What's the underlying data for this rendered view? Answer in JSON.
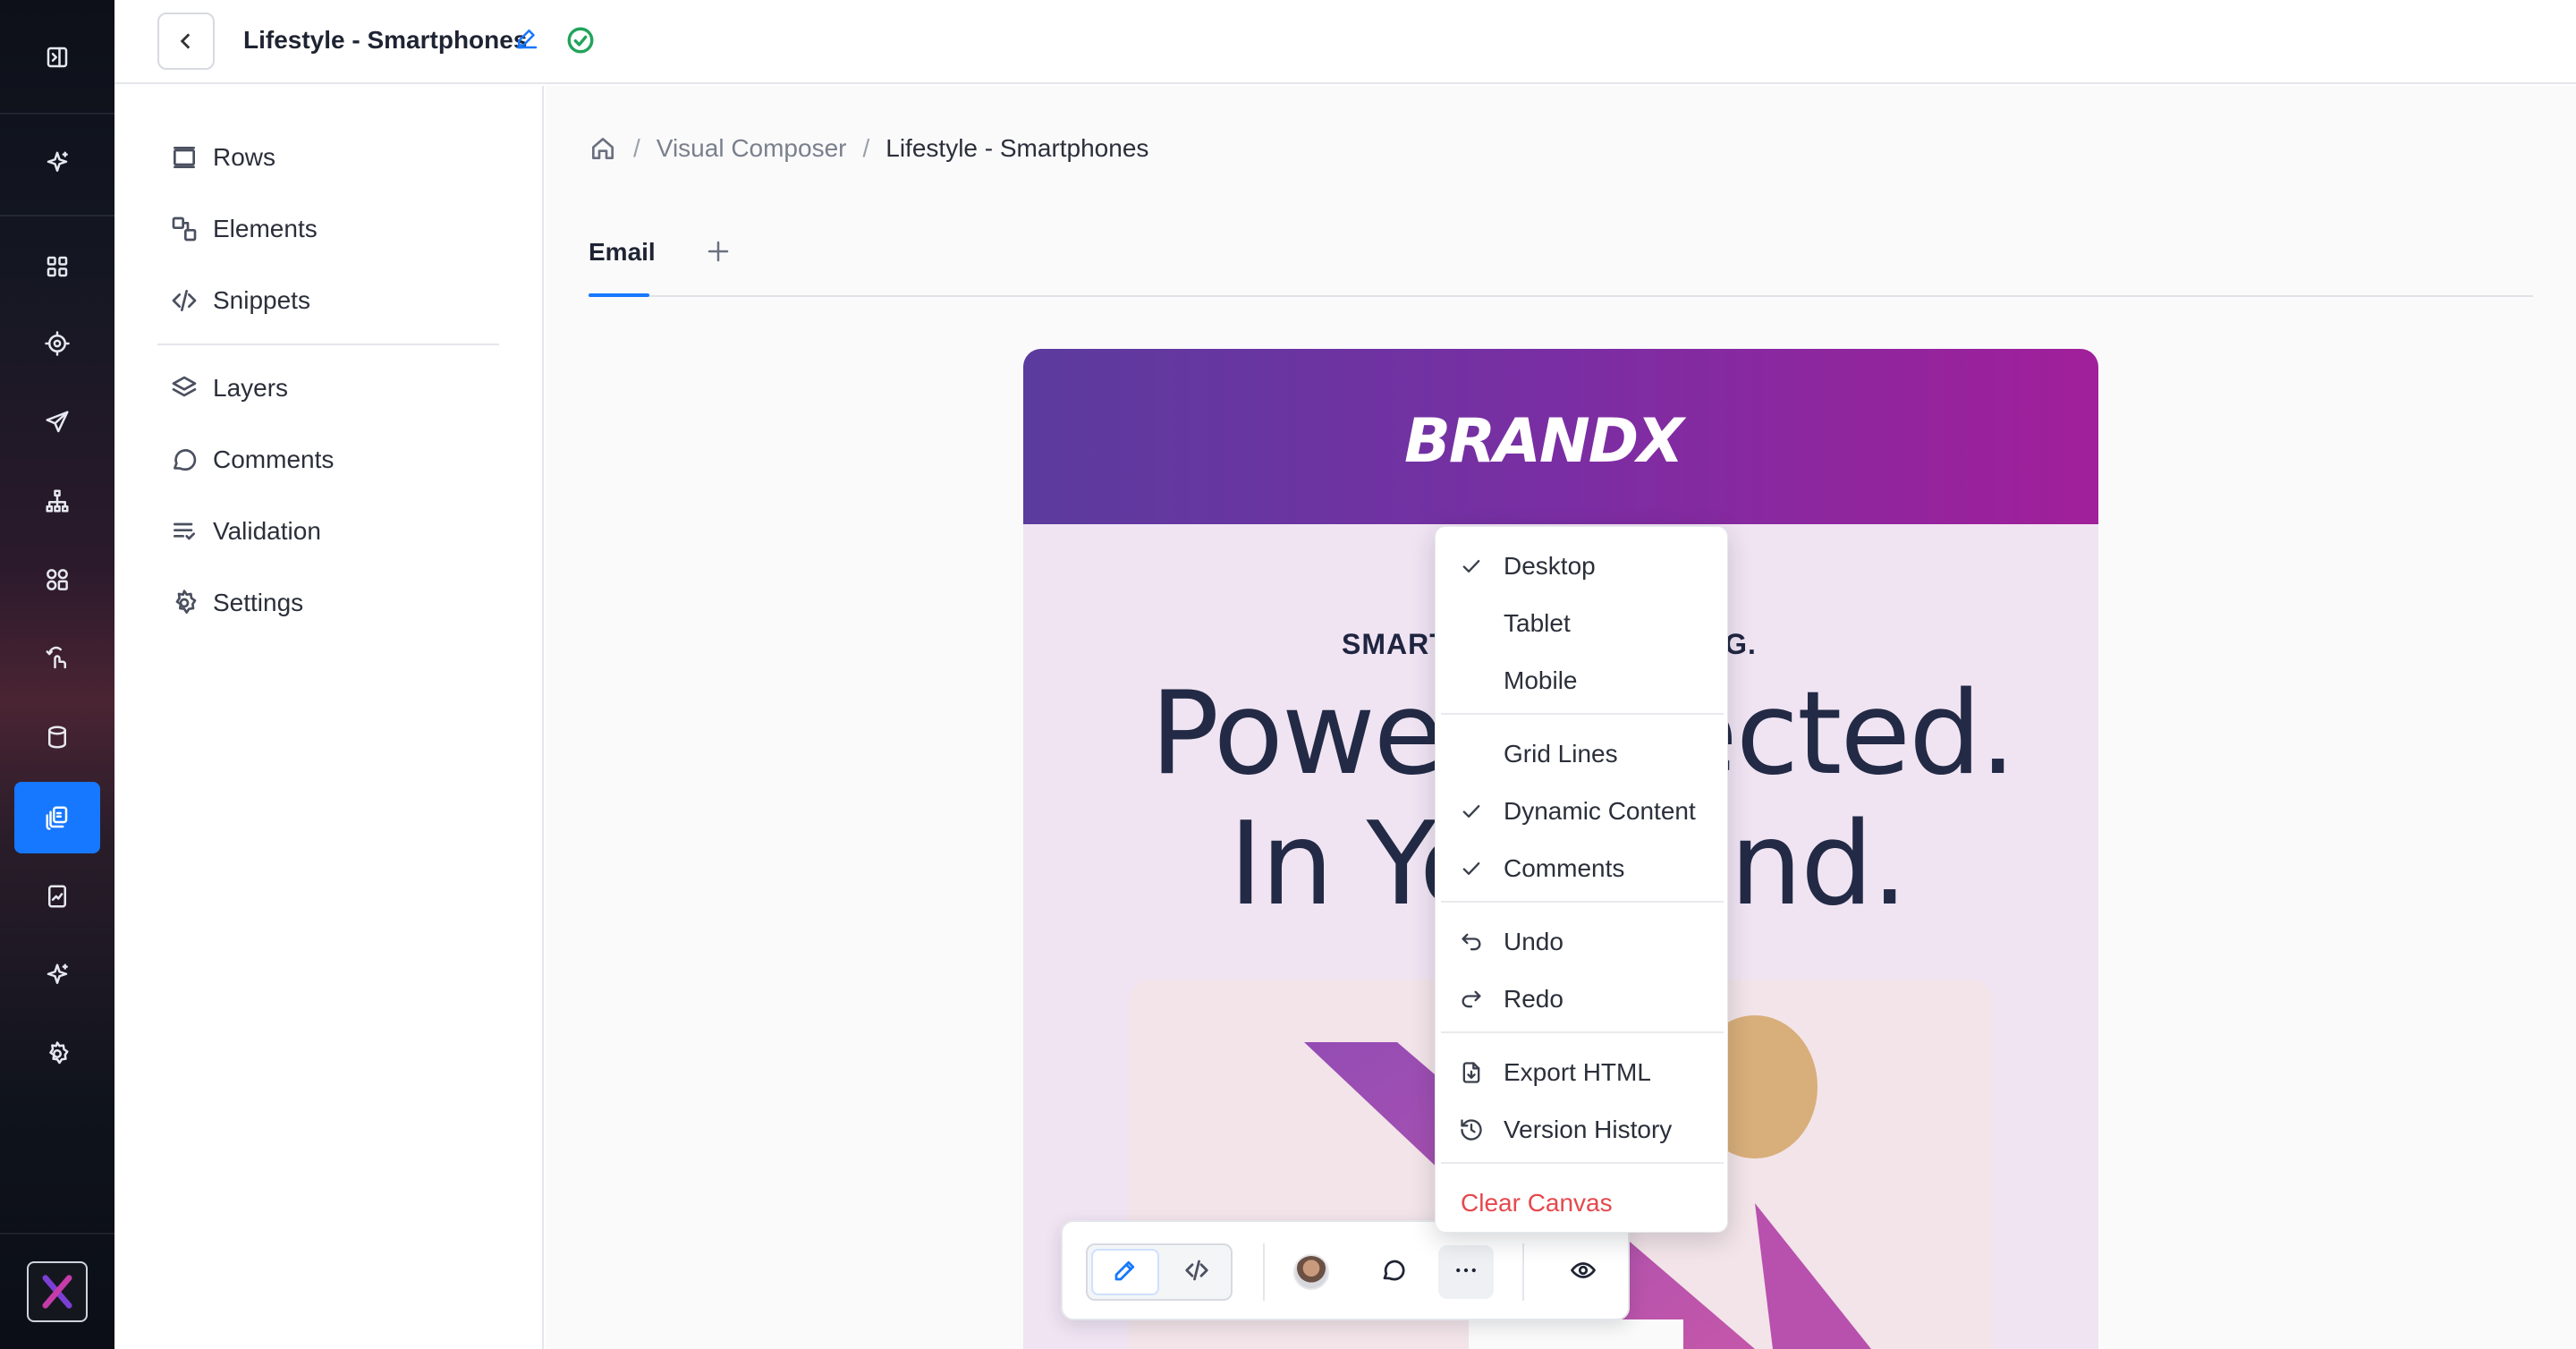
{
  "topbar": {
    "title": "Lifestyle - Smartphones"
  },
  "sidebar": {
    "items": [
      {
        "label": "Rows",
        "icon": "rows-icon"
      },
      {
        "label": "Elements",
        "icon": "elements-icon"
      },
      {
        "label": "Snippets",
        "icon": "code-icon"
      },
      {
        "label": "Layers",
        "icon": "layers-icon"
      },
      {
        "label": "Comments",
        "icon": "comment-icon"
      },
      {
        "label": "Validation",
        "icon": "validation-icon"
      },
      {
        "label": "Settings",
        "icon": "gear-icon"
      }
    ]
  },
  "breadcrumb": {
    "home_icon": "home-icon",
    "items": [
      "Visual Composer",
      "Lifestyle - Smartphones"
    ],
    "separator": "/"
  },
  "tabs": {
    "active": "Email"
  },
  "email": {
    "brand": "BRANDX",
    "kicker": "SMART",
    "kicker_tail": "NG.",
    "headline_line1_left": "Power",
    "headline_line1_right": "ected.",
    "headline_line2_left": "In Yo",
    "headline_line2_right": "nd.",
    "colors": {
      "header_start": "#5b3b9e",
      "header_end": "#a11f9a",
      "body_bg": "#f0e4f3"
    }
  },
  "menu": {
    "items": [
      {
        "label": "Desktop",
        "checked": true
      },
      {
        "label": "Tablet",
        "checked": false
      },
      {
        "label": "Mobile",
        "checked": false
      },
      {
        "label": "Grid Lines",
        "checked": false
      },
      {
        "label": "Dynamic Content",
        "checked": true
      },
      {
        "label": "Comments",
        "checked": true
      },
      {
        "label": "Undo",
        "icon": "undo-icon"
      },
      {
        "label": "Redo",
        "icon": "redo-icon"
      },
      {
        "label": "Export HTML",
        "icon": "export-icon"
      },
      {
        "label": "Version History",
        "icon": "history-icon"
      },
      {
        "label": "Clear Canvas",
        "danger": true
      }
    ]
  },
  "colors": {
    "accent": "#1677ff",
    "success": "#22a35a",
    "danger": "#e5484d"
  }
}
